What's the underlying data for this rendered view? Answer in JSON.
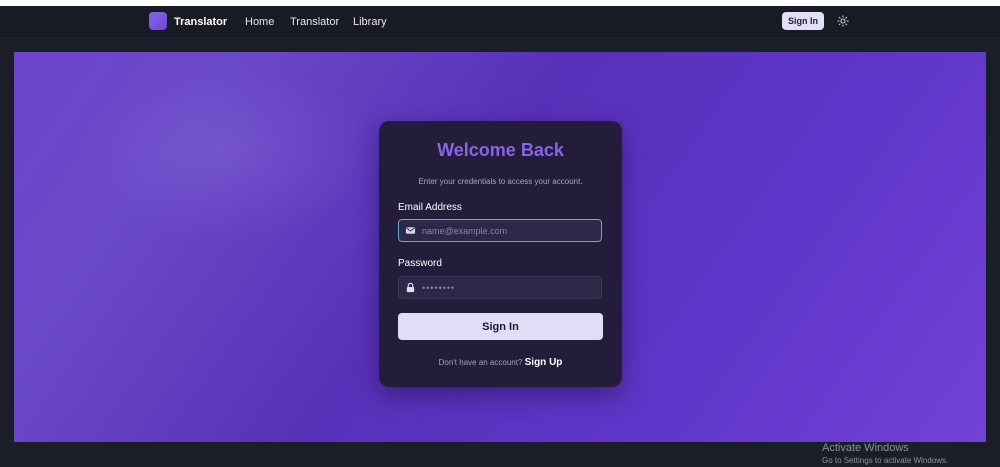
{
  "nav": {
    "brand": "Translator",
    "links": [
      "Home",
      "Translator",
      "Library"
    ],
    "signin_label": "Sign In"
  },
  "card": {
    "title": "Welcome Back",
    "subtitle": "Enter your credentials to access your account.",
    "email_label": "Email Address",
    "email_placeholder": "name@example.com",
    "password_label": "Password",
    "password_placeholder": "••••••••",
    "submit_label": "Sign In",
    "footer_text": "Don't have an account?",
    "footer_link": "Sign Up"
  },
  "icons": {
    "logo": "logo-icon",
    "theme": "sun-icon",
    "email": "mail-icon",
    "password": "lock-icon"
  },
  "colors": {
    "accent": "#8a64e6",
    "hero_start": "#6d43cd",
    "hero_end": "#7142d6",
    "card_bg": "#231c3a",
    "button_bg": "#e2ddf6",
    "focus_border": "#69a8d8"
  },
  "watermark": {
    "title": "Activate Windows",
    "subtitle": "Go to Settings to activate Windows."
  }
}
